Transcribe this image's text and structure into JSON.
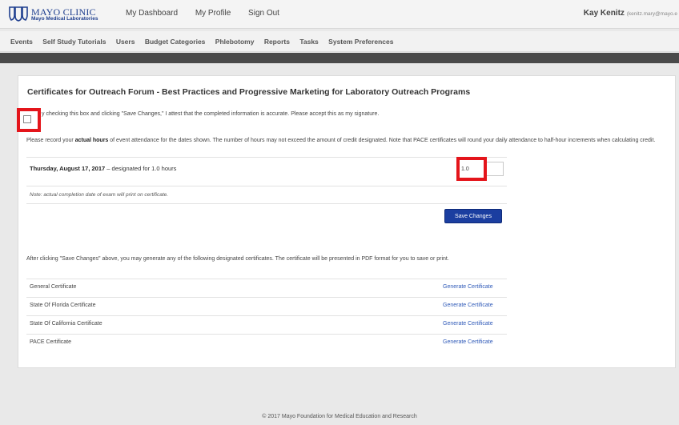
{
  "header": {
    "brand_name": "MAYO CLINIC",
    "brand_sub": "Mayo Medical Laboratories",
    "nav": [
      "My Dashboard",
      "My Profile",
      "Sign Out"
    ],
    "user_name": "Kay Kenitz",
    "user_email": "(kenitz.mary@mayo.e"
  },
  "menu": [
    "Events",
    "Self Study Tutorials",
    "Users",
    "Budget Categories",
    "Phlebotomy",
    "Reports",
    "Tasks",
    "System Preferences"
  ],
  "card": {
    "title": "Certificates for Outreach Forum - Best Practices and Progressive Marketing for Laboratory Outreach Programs",
    "attest_text": "y checking this box and clicking \"Save Changes,\" I attest that the completed information is accurate. Please accept this as my signature.",
    "instr_before": "Please record your ",
    "instr_bold": "actual hours",
    "instr_after": " of event attendance for the dates shown. The number of hours may not exceed the amount of credit designated. Note that PACE certificates will round your daily attendance to half-hour increments when calculating credit.",
    "date_bold": "Thursday, August 17, 2017",
    "date_rest": " – designated for 1.0 hours",
    "hours_value": "1.0",
    "note": "Note: actual completion date of exam will print on certificate.",
    "save_label": "Save Changes",
    "after_text": "After clicking \"Save Changes\" above, you may generate any of the following designated certificates. The certificate will be presented in PDF format for you to save or print.",
    "certificates": [
      {
        "name": "General Certificate",
        "link": "Generate Certificate"
      },
      {
        "name": "State Of Florida Certificate",
        "link": "Generate Certificate"
      },
      {
        "name": "State Of California Certificate",
        "link": "Generate Certificate"
      },
      {
        "name": "PACE Certificate",
        "link": "Generate Certificate"
      }
    ]
  },
  "footer": "© 2017 Mayo Foundation for Medical Education and Research",
  "colors": {
    "accent": "#1b3ea0",
    "highlight": "#e4151b",
    "link": "#2f5ab8"
  }
}
